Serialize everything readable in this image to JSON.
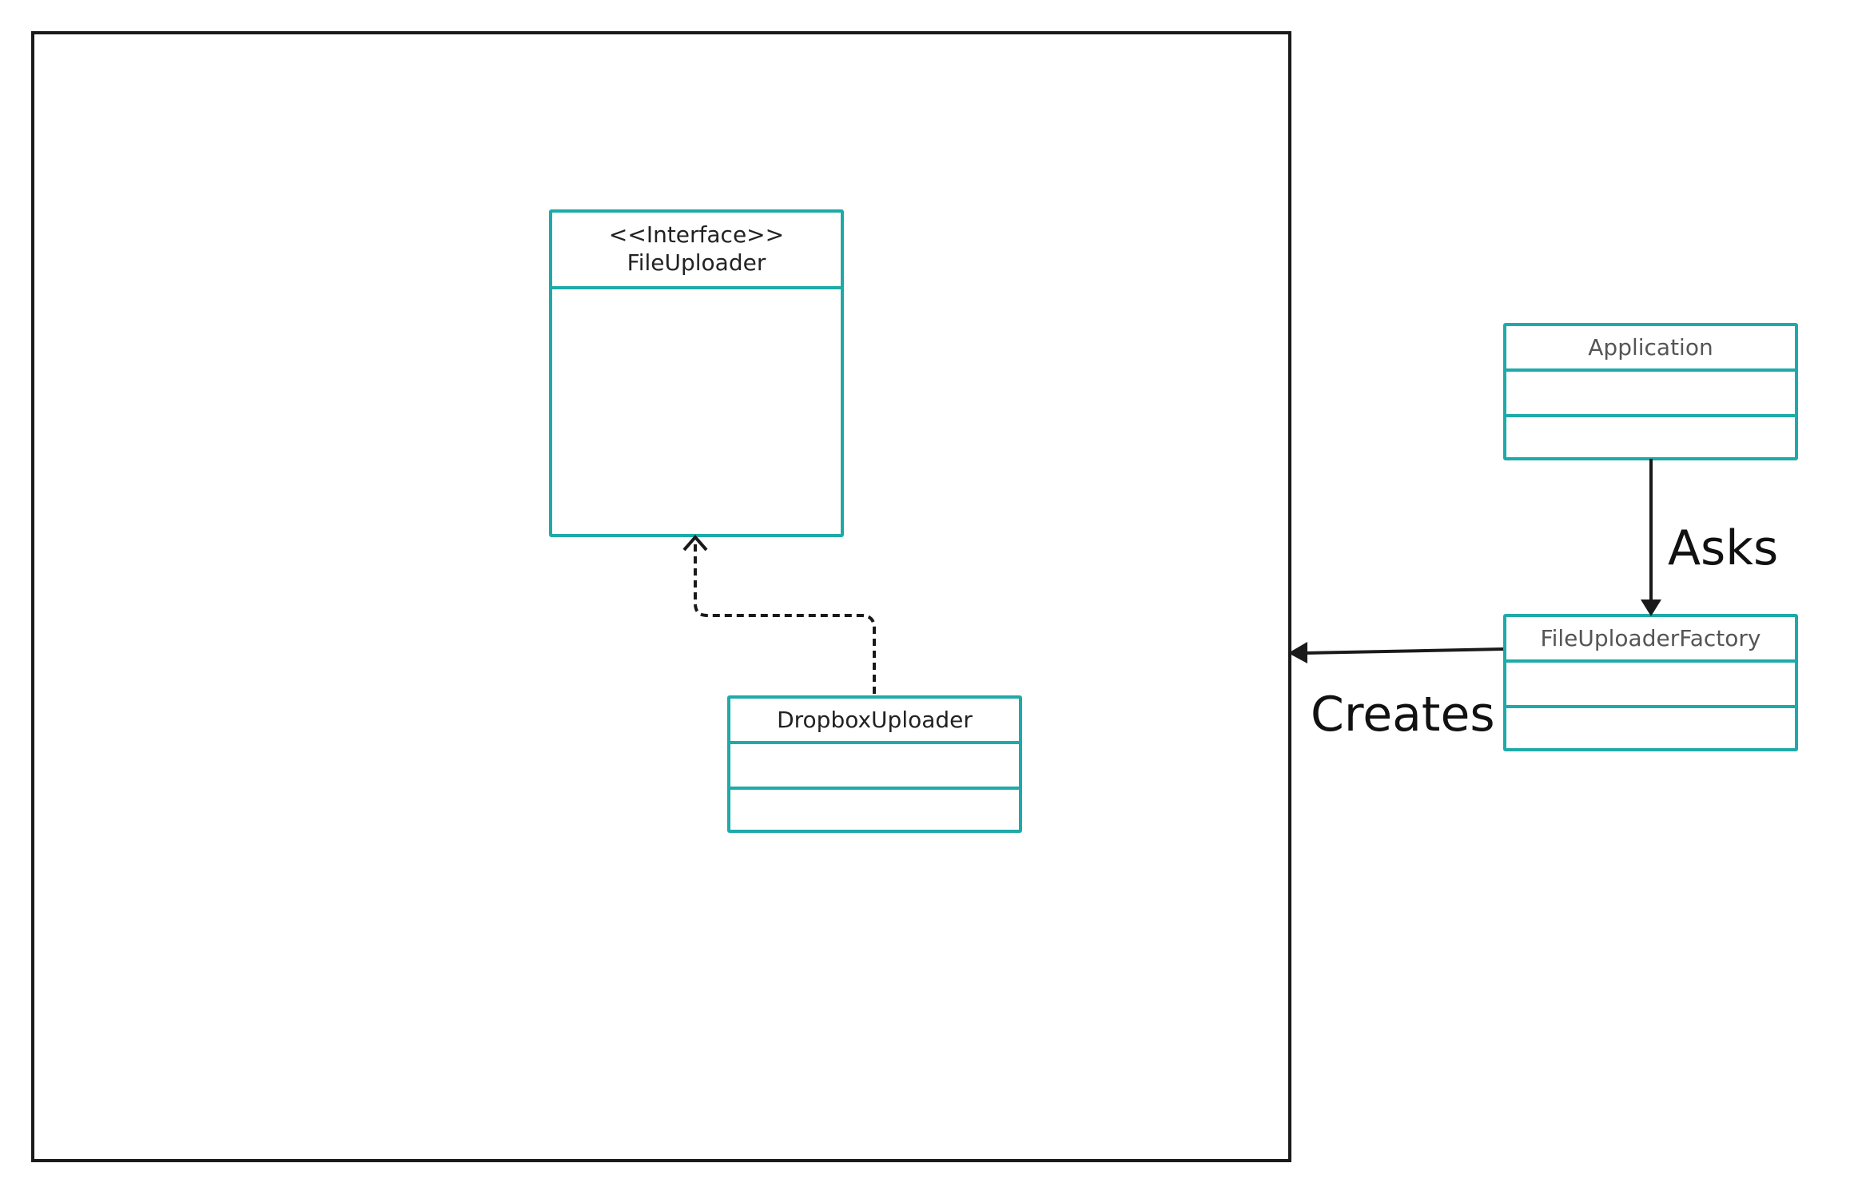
{
  "diagram": {
    "classes": {
      "file_uploader": {
        "stereotype": "<<Interface>>",
        "name": "FileUploader"
      },
      "dropbox_uploader": {
        "name": "DropboxUploader"
      },
      "application": {
        "name": "Application"
      },
      "file_uploader_factory": {
        "name": "FileUploaderFactory"
      }
    },
    "relations": {
      "asks_label": "Asks",
      "creates_label": "Creates"
    },
    "colors": {
      "class_border": "#1eaaa8",
      "line": "#1a1a1a"
    }
  }
}
